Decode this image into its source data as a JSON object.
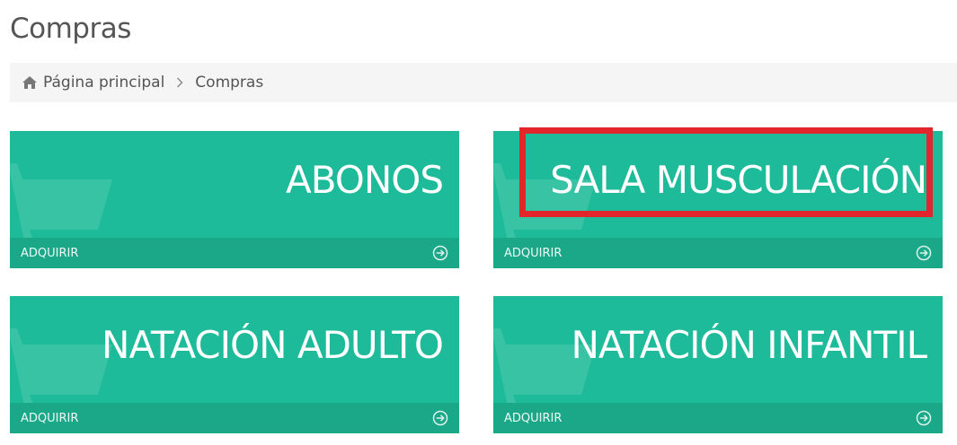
{
  "page": {
    "title": "Compras"
  },
  "breadcrumb": {
    "home_icon": "home-icon",
    "items": [
      {
        "label": "Página principal"
      },
      {
        "label": "Compras"
      }
    ]
  },
  "tiles": [
    {
      "title": "ABONOS",
      "action_label": "ADQUIRIR",
      "icon": "arrow-circle-right-icon"
    },
    {
      "title": "SALA MUSCULACIÓN",
      "action_label": "ADQUIRIR",
      "icon": "arrow-circle-right-icon"
    },
    {
      "title": "NATACIÓN ADULTO",
      "action_label": "ADQUIRIR",
      "icon": "arrow-circle-right-icon"
    },
    {
      "title": "NATACIÓN INFANTIL",
      "action_label": "ADQUIRIR",
      "icon": "arrow-circle-right-icon"
    }
  ],
  "colors": {
    "tile_background": "#1dbb99",
    "tile_footer": "#1aa888",
    "highlight": "#e3262b",
    "breadcrumb_background": "#f5f5f5"
  }
}
